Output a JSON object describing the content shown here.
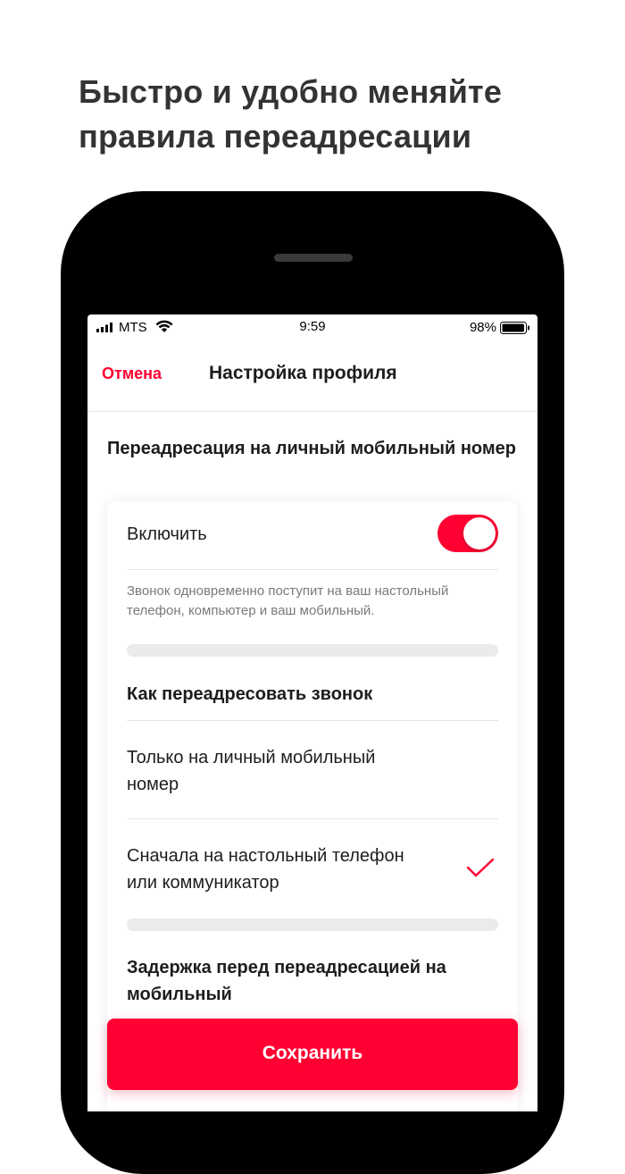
{
  "promo": {
    "headline_line1": "Быстро и удобно меняйте",
    "headline_line2": "правила переадресации"
  },
  "status_bar": {
    "carrier": "MTS",
    "time": "9:59",
    "battery": "98%",
    "icons": [
      "signal-icon",
      "wifi-icon",
      "battery-icon"
    ]
  },
  "nav": {
    "cancel_label": "Отмена",
    "title": "Настройка профиля"
  },
  "forwarding": {
    "heading": "Переадресация на личный мобильный номер",
    "toggle_label": "Включить",
    "toggle_on": true,
    "hint": "Звонок одновременно поступит на ваш настольный телефон, компьютер и ваш мобильный."
  },
  "how_to_forward": {
    "heading": "Как переадресовать звонок",
    "options": [
      {
        "label": "Только на личный мобильный номер",
        "selected": false
      },
      {
        "label": "Сначала на настольный телефон или коммуникатор",
        "selected": true
      }
    ]
  },
  "delay": {
    "heading": "Задержка перед переадресацией на мобильный"
  },
  "save_label": "Сохранить",
  "colors": {
    "accent": "#ff0032",
    "text": "#1d1d1f",
    "muted": "#7a7a7a",
    "headline": "#333333"
  }
}
